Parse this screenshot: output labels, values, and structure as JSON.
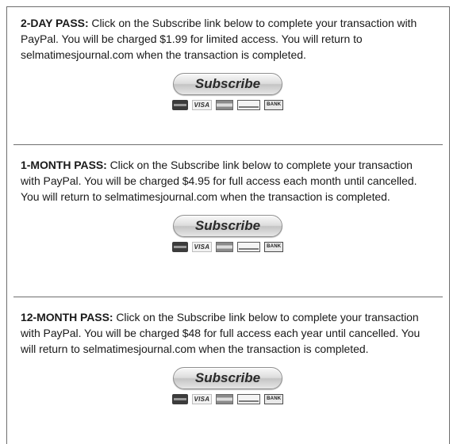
{
  "passes": [
    {
      "id": "2-day",
      "title": "2-DAY PASS:",
      "description": " Click on the Subscribe link below to complete your transaction with PayPal. You will be charged $1.99 for limited access. You will return to selmatimesjournal.com when the transaction is completed.",
      "button_label": "Subscribe"
    },
    {
      "id": "1-month",
      "title": "1-MONTH PASS:",
      "description": " Click on the Subscribe link below to complete your transaction with PayPal. You will be charged $4.95 for full access each month until cancelled. You will return to selmatimesjournal.com when the transaction is completed.",
      "button_label": "Subscribe"
    },
    {
      "id": "12-month",
      "title": "12-MONTH PASS:",
      "description": " Click on the Subscribe link below to complete your transaction with PayPal. You will be charged $48 for full access each year until cancelled. You will return to selmatimesjournal.com when the transaction is completed.",
      "button_label": "Subscribe"
    }
  ],
  "payment_cards": [
    {
      "icon": "mastercard-icon",
      "label": ""
    },
    {
      "icon": "visa-icon",
      "label": "VISA"
    },
    {
      "icon": "amex-icon",
      "label": ""
    },
    {
      "icon": "discover-icon",
      "label": ""
    },
    {
      "icon": "bank-icon",
      "label": "BANK"
    }
  ],
  "colors": {
    "text": "#1a1a1a",
    "border": "#6e6e6e",
    "button_text": "#2a2a2a"
  }
}
